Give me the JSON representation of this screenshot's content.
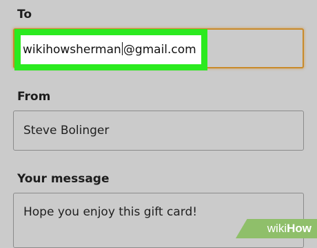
{
  "to": {
    "label": "To",
    "email_before_caret": "wikihowsherman",
    "email_after_caret": "@gmail.com"
  },
  "from": {
    "label": "From",
    "value": "Steve Bolinger"
  },
  "message": {
    "label": "Your message",
    "value": "Hope you enjoy this gift card!"
  },
  "watermark": {
    "part1": "wiki",
    "part2": "How"
  },
  "colors": {
    "background": "#cbcbcb",
    "highlight_border": "#2bea1f",
    "focus_border": "#c98a2a",
    "watermark_bg": "#8fbf6a"
  }
}
